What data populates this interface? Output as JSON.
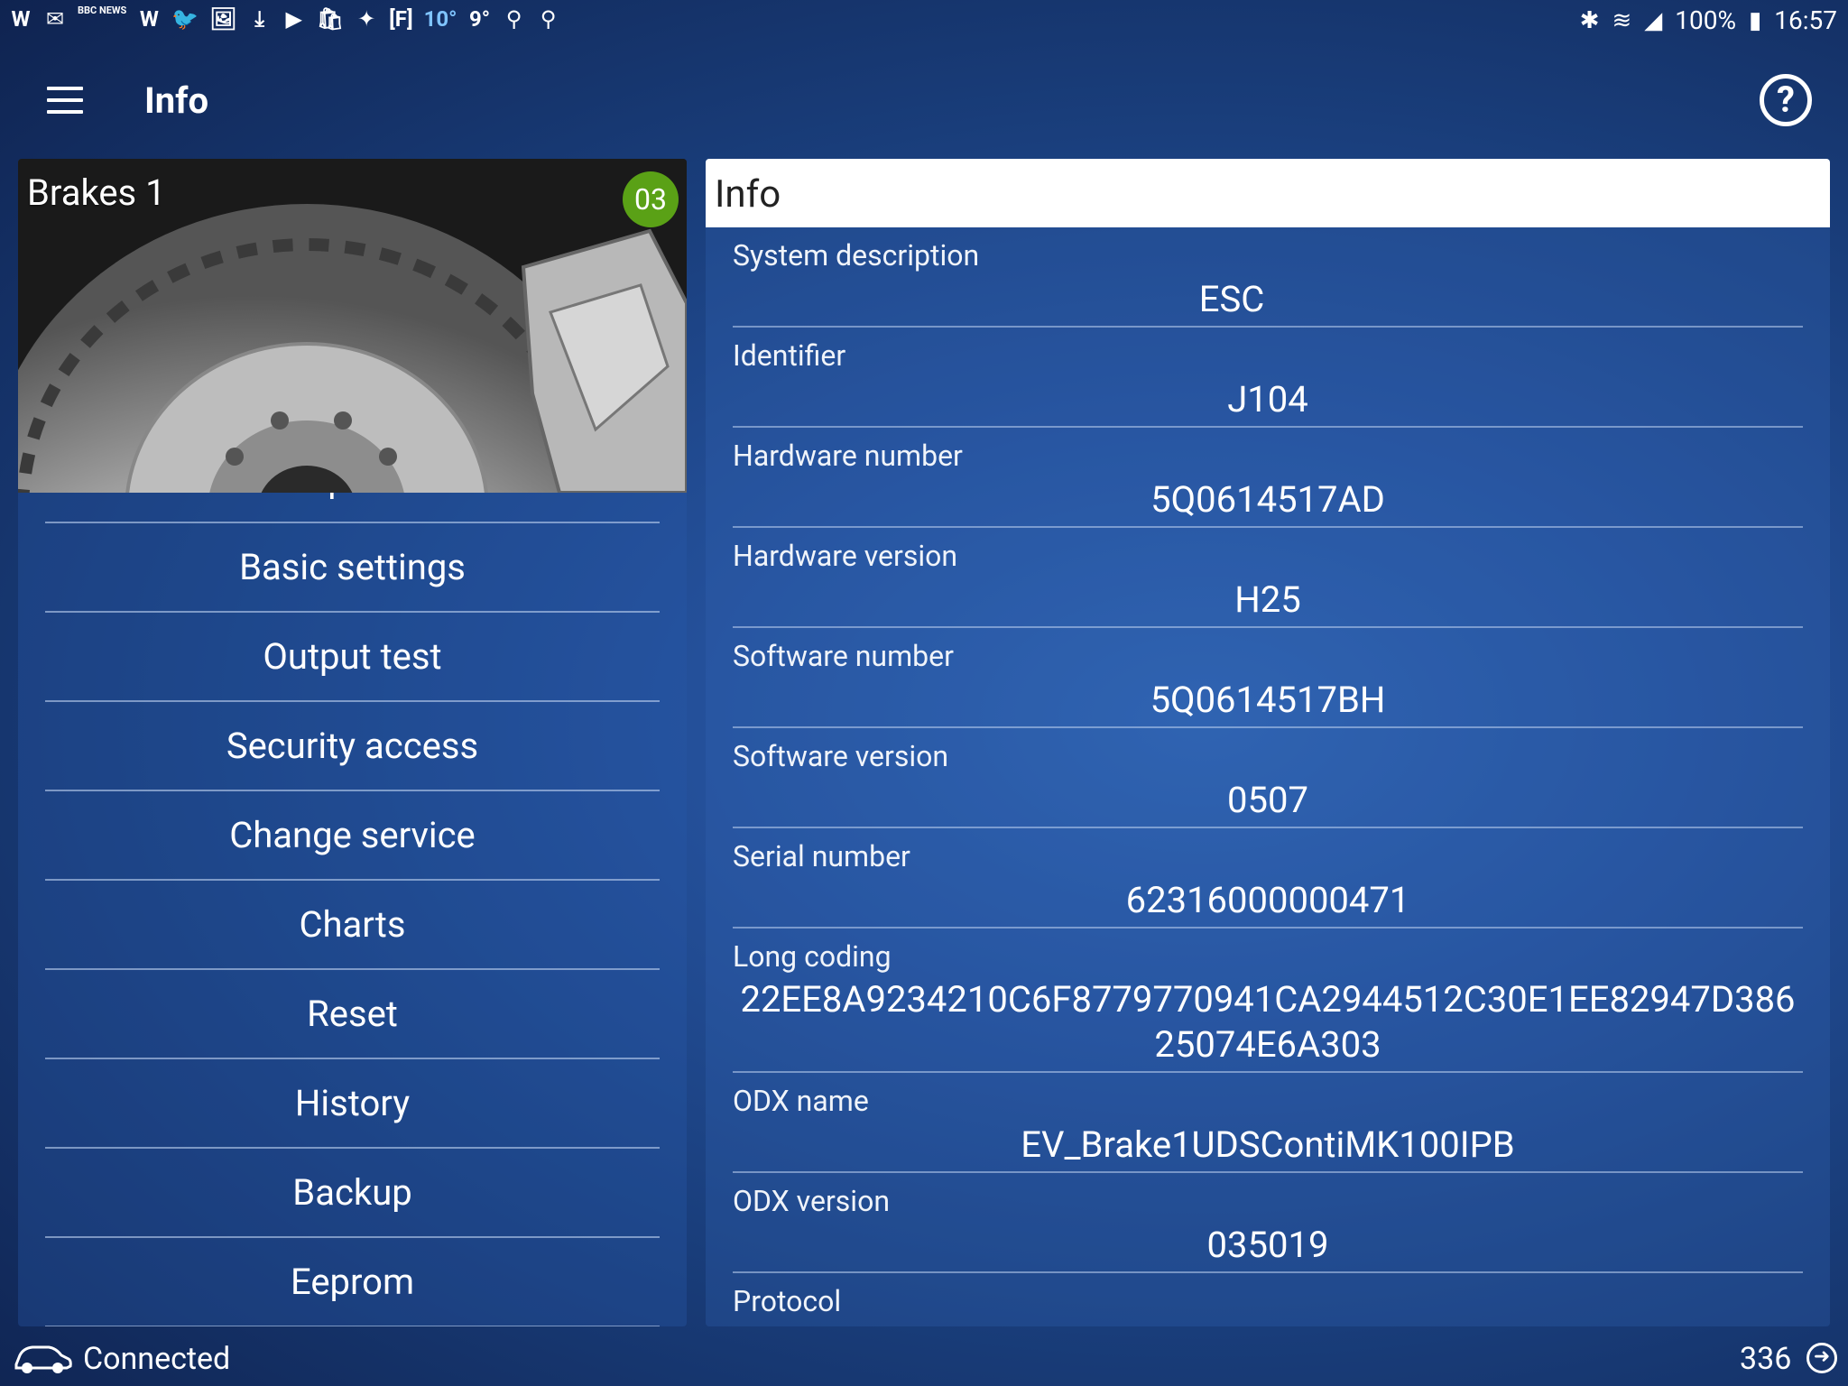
{
  "status_bar": {
    "left_icons": [
      "W",
      "✉",
      "BBC NEWS",
      "W",
      "🐦",
      "🖼",
      "⤓",
      "▶",
      "🛍",
      "✦",
      "[F]"
    ],
    "temp1": "10°",
    "temp2": "9°",
    "battery": "100%",
    "time": "16:57"
  },
  "app_bar": {
    "title": "Info"
  },
  "module": {
    "title": "Brakes 1",
    "badge": "03"
  },
  "menu": {
    "partial_item": "Adaptation",
    "items": [
      "Basic settings",
      "Output test",
      "Security access",
      "Change service",
      "Charts",
      "Reset",
      "History",
      "Backup",
      "Eeprom"
    ]
  },
  "info_panel": {
    "header": "Info",
    "fields": [
      {
        "label": "System description",
        "value": "ESC"
      },
      {
        "label": "Identifier",
        "value": "J104"
      },
      {
        "label": "Hardware number",
        "value": "5Q0614517AD"
      },
      {
        "label": "Hardware version",
        "value": "H25"
      },
      {
        "label": "Software number",
        "value": "5Q0614517BH"
      },
      {
        "label": "Software version",
        "value": "0507"
      },
      {
        "label": "Serial number",
        "value": "62316000000471"
      },
      {
        "label": "Long coding",
        "value": "22EE8A9234210C6F8779770941CA2944512C30E1EE82947D38625074E6A303"
      },
      {
        "label": "ODX name",
        "value": "EV_Brake1UDSContiMK100IPB"
      },
      {
        "label": "ODX version",
        "value": "035019"
      },
      {
        "label": "Protocol",
        "value": ""
      }
    ]
  },
  "bottom_bar": {
    "connection": "Connected",
    "count": "336"
  },
  "colors": {
    "badge": "#5aa116",
    "background": "#1f4a90"
  }
}
